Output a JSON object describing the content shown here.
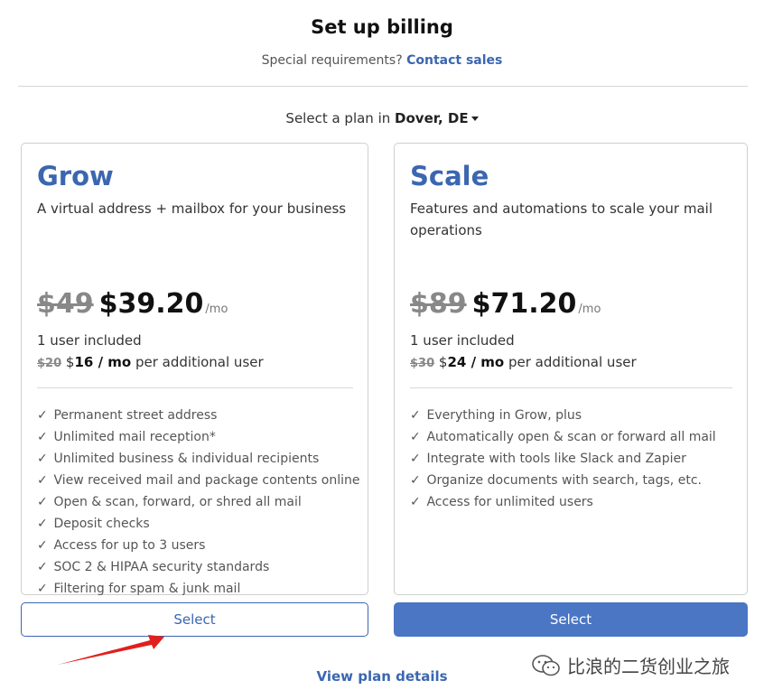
{
  "header": {
    "title": "Set up billing",
    "subtitle_prefix": "Special requirements?",
    "contact_link": "Contact sales"
  },
  "location": {
    "prefix": "Select a plan in",
    "value": "Dover, DE"
  },
  "plans": [
    {
      "name": "Grow",
      "description": "A virtual address + mailbox for your business",
      "old_price": "$49",
      "new_price": "$39.20",
      "per": "/mo",
      "users_included": "1 user included",
      "extra_old": "$20",
      "extra_new_dollar": "$",
      "extra_new": "16 / mo",
      "extra_suffix": "per additional user",
      "features": [
        "Permanent street address",
        "Unlimited mail reception*",
        "Unlimited business & individual recipients",
        "View received mail and package contents online",
        "Open & scan, forward, or shred all mail",
        "Deposit checks",
        "Access for up to 3 users",
        "SOC 2 & HIPAA security standards",
        "Filtering for spam & junk mail"
      ],
      "button_label": "Select"
    },
    {
      "name": "Scale",
      "description": "Features and automations to scale your mail operations",
      "old_price": "$89",
      "new_price": "$71.20",
      "per": "/mo",
      "users_included": "1 user included",
      "extra_old": "$30",
      "extra_new_dollar": "$",
      "extra_new": "24 / mo",
      "extra_suffix": "per additional user",
      "features": [
        "Everything in Grow, plus",
        "Automatically open & scan or forward all mail",
        "Integrate with tools like Slack and Zapier",
        "Organize documents with search, tags, etc.",
        "Access for unlimited users"
      ],
      "button_label": "Select"
    }
  ],
  "footer": {
    "details_link": "View plan details"
  },
  "check_glyph": "✓",
  "watermark": {
    "text": "比浪的二货创业之旅",
    "icon": "wechat-icon"
  },
  "colors": {
    "accent": "#3b66b0",
    "primary_button": "#4a76c4",
    "annotation_arrow": "#e0201e"
  }
}
